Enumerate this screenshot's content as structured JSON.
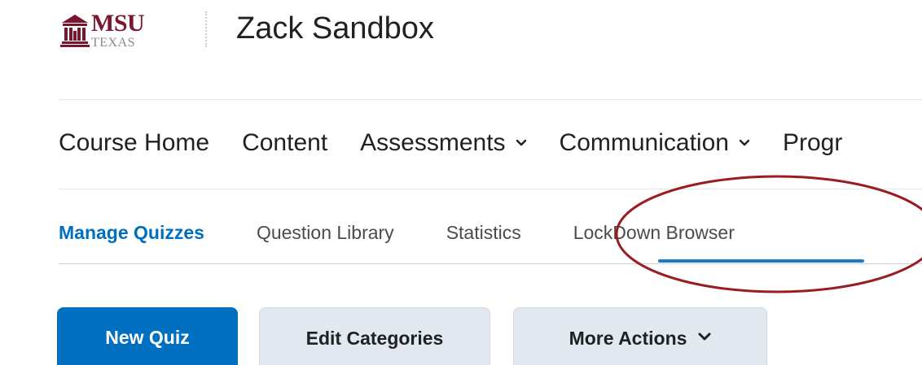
{
  "header": {
    "logo": {
      "primary": "MSU",
      "secondary": "TEXAS"
    },
    "course_title": "Zack Sandbox"
  },
  "course_nav": {
    "items": [
      {
        "label": "Course Home",
        "has_dropdown": false
      },
      {
        "label": "Content",
        "has_dropdown": false
      },
      {
        "label": "Assessments",
        "has_dropdown": true
      },
      {
        "label": "Communication",
        "has_dropdown": true
      },
      {
        "label": "Progr",
        "has_dropdown": false
      }
    ]
  },
  "sub_tabs": {
    "items": [
      {
        "label": "Manage Quizzes",
        "active": true
      },
      {
        "label": "Question Library",
        "active": false
      },
      {
        "label": "Statistics",
        "active": false
      },
      {
        "label": "LockDown Browser",
        "active": false
      }
    ],
    "highlighted": "LockDown Browser"
  },
  "actions": {
    "new_quiz": "New Quiz",
    "edit_categories": "Edit Categories",
    "more_actions": "More Actions"
  },
  "colors": {
    "primary": "#006fbf",
    "logo_maroon": "#7a1730",
    "annotation": "#9b1b22",
    "tab_underline": "#1f7ac8",
    "secondary_button": "#e3e9f1"
  },
  "icons": {
    "dropdown": "chevron-down-icon",
    "logo": "msu-building-icon"
  }
}
